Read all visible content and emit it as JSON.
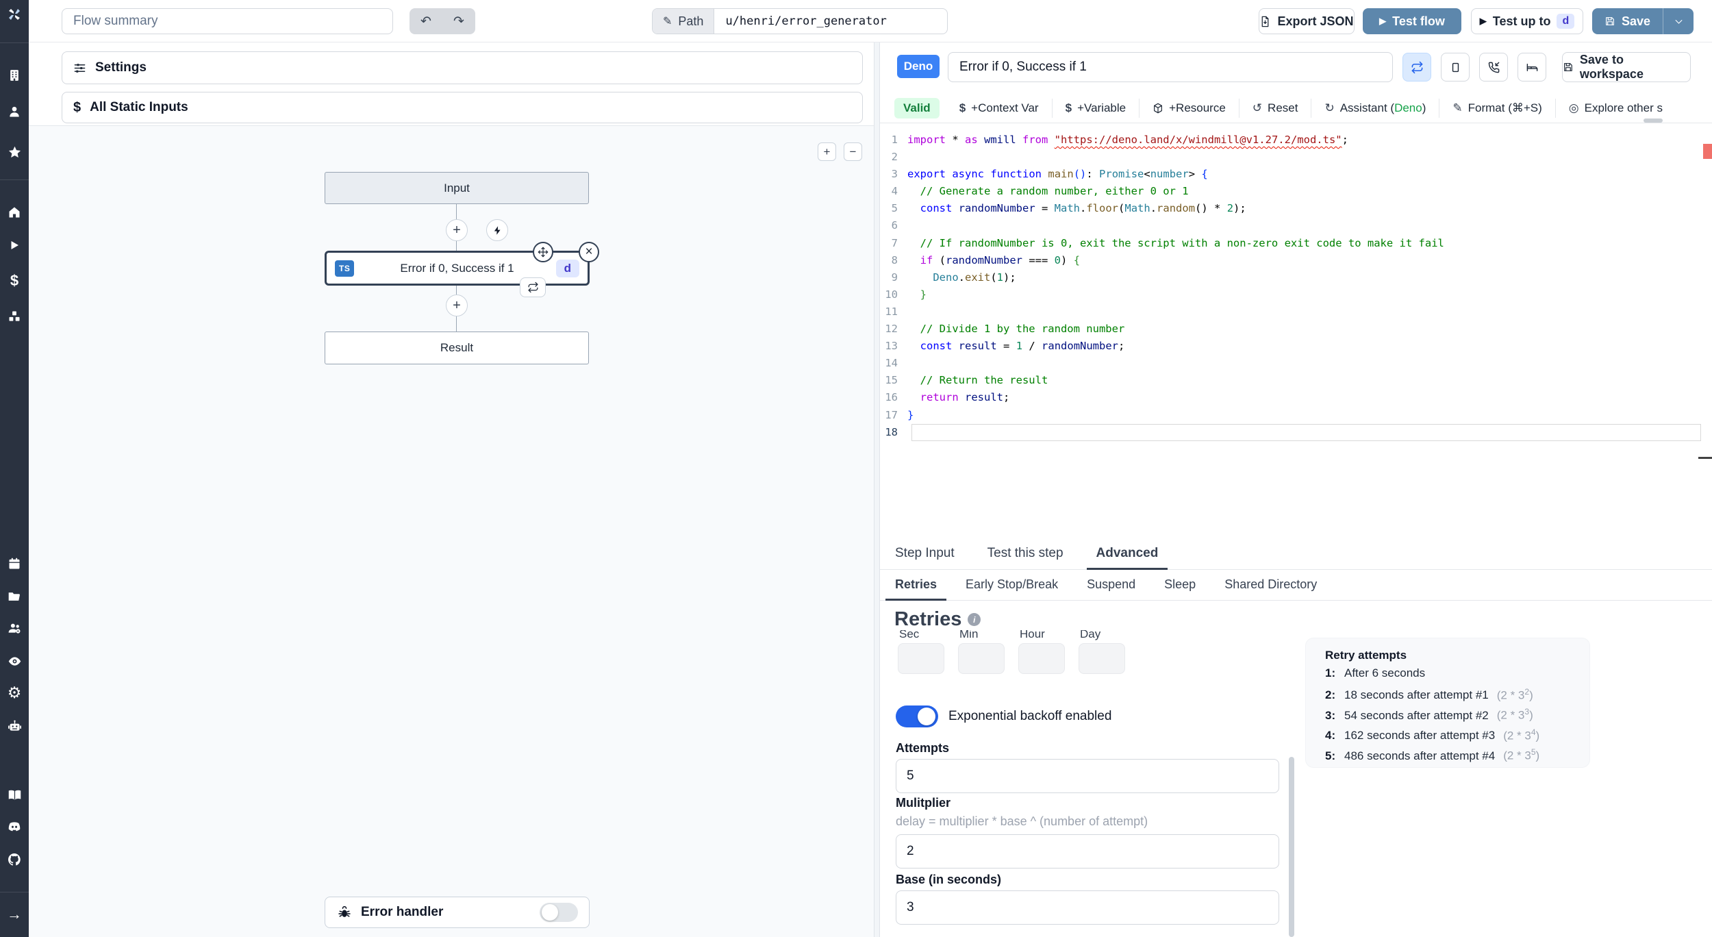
{
  "colors": {
    "accent_button": "#5d87ac",
    "deno_badge": "#3b82f6",
    "ts_badge": "#3178c6",
    "d_badge_text": "#4338ca",
    "valid_green": "#15803d",
    "toggle_on": "#2563eb",
    "sidebar_bg": "#2a3240",
    "canvas_bg": "#f8fafc"
  },
  "icons": {
    "undo": "↶",
    "redo": "↷",
    "pencil": "✎",
    "play": "▶",
    "dollar": "$",
    "reset": "↺",
    "assistant": "↻",
    "format": "✎",
    "explore": "◎",
    "close": "×",
    "plus": "+",
    "minus": "−",
    "info": "i",
    "arrow_right": "→",
    "gear": "⚙",
    "star": "★"
  },
  "sidebar": {
    "icons": [
      "windmill-logo",
      "building",
      "user",
      "star",
      "home",
      "play",
      "dollar",
      "boxes",
      "calendar",
      "folder",
      "users-gear",
      "eye",
      "gear",
      "robot",
      "book",
      "discord",
      "github",
      "arrow-right"
    ]
  },
  "topbar": {
    "flow_summary_placeholder": "Flow summary",
    "path_label": "Path",
    "path_value": "u/henri/error_generator",
    "export_json": "Export JSON",
    "test_flow": "Test flow",
    "test_up_to": "Test up to",
    "test_up_to_badge": "d",
    "save": "Save"
  },
  "left_panel": {
    "settings": "Settings",
    "all_static_inputs": "All Static Inputs"
  },
  "flow": {
    "input_node": "Input",
    "step_node": {
      "lang_badge": "TS",
      "title": "Error if 0, Success if 1",
      "id_badge": "d"
    },
    "result_node": "Result",
    "error_handler": "Error handler"
  },
  "step_editor": {
    "lang_badge": "Deno",
    "summary_value": "Error if 0, Success if 1",
    "save_to_workspace": "Save to workspace",
    "valid": "Valid",
    "toolbar": {
      "context_var": "+Context Var",
      "variable": "+Variable",
      "resource": "+Resource",
      "reset": "Reset",
      "assistant_prefix": "Assistant (",
      "assistant_lang": "Deno",
      "assistant_suffix": ")",
      "format": "Format (⌘+S)",
      "explore": "Explore other s"
    }
  },
  "editor": {
    "active_line": 18,
    "lines": [
      {
        "segs": [
          [
            "kw2",
            "import"
          ],
          [
            "d",
            " * "
          ],
          [
            "kw2",
            "as"
          ],
          [
            "v",
            " wmill "
          ],
          [
            "kw2",
            "from"
          ],
          [
            "d",
            " "
          ],
          [
            "str-u",
            "\"https://deno.land/x/windmill@v1.27.2/mod.ts\""
          ],
          [
            "d",
            ";"
          ]
        ]
      },
      {
        "segs": []
      },
      {
        "segs": [
          [
            "kw",
            "export"
          ],
          [
            "d",
            " "
          ],
          [
            "kw",
            "async"
          ],
          [
            "d",
            " "
          ],
          [
            "kw",
            "function"
          ],
          [
            "d",
            " "
          ],
          [
            "fn",
            "main"
          ],
          [
            "b1",
            "()"
          ],
          [
            "d",
            ": "
          ],
          [
            "ty",
            "Promise"
          ],
          [
            "d",
            "<"
          ],
          [
            "ty",
            "number"
          ],
          [
            "d",
            "> "
          ],
          [
            "b1",
            "{"
          ]
        ]
      },
      {
        "segs": [
          [
            "c",
            "  // Generate a random number, either 0 or 1"
          ]
        ]
      },
      {
        "segs": [
          [
            "d",
            "  "
          ],
          [
            "kw",
            "const"
          ],
          [
            "d",
            " "
          ],
          [
            "v",
            "randomNumber"
          ],
          [
            "d",
            " = "
          ],
          [
            "ty",
            "Math"
          ],
          [
            "d",
            "."
          ],
          [
            "fn",
            "floor"
          ],
          [
            "d",
            "("
          ],
          [
            "ty",
            "Math"
          ],
          [
            "d",
            "."
          ],
          [
            "fn",
            "random"
          ],
          [
            "d",
            "() * "
          ],
          [
            "num",
            "2"
          ],
          [
            "d",
            ");"
          ]
        ]
      },
      {
        "segs": []
      },
      {
        "segs": [
          [
            "c",
            "  // If randomNumber is 0, exit the script with a non-zero exit code to make it fail"
          ]
        ]
      },
      {
        "segs": [
          [
            "d",
            "  "
          ],
          [
            "kw2",
            "if"
          ],
          [
            "d",
            " ("
          ],
          [
            "v",
            "randomNumber"
          ],
          [
            "d",
            " === "
          ],
          [
            "num",
            "0"
          ],
          [
            "d",
            ") "
          ],
          [
            "b2",
            "{"
          ]
        ]
      },
      {
        "segs": [
          [
            "d",
            "    "
          ],
          [
            "ty",
            "Deno"
          ],
          [
            "d",
            "."
          ],
          [
            "fn",
            "exit"
          ],
          [
            "d",
            "("
          ],
          [
            "num",
            "1"
          ],
          [
            "d",
            ");"
          ]
        ]
      },
      {
        "segs": [
          [
            "d",
            "  "
          ],
          [
            "b2",
            "}"
          ]
        ]
      },
      {
        "segs": []
      },
      {
        "segs": [
          [
            "c",
            "  // Divide 1 by the random number"
          ]
        ]
      },
      {
        "segs": [
          [
            "d",
            "  "
          ],
          [
            "kw",
            "const"
          ],
          [
            "d",
            " "
          ],
          [
            "v",
            "result"
          ],
          [
            "d",
            " = "
          ],
          [
            "num",
            "1"
          ],
          [
            "d",
            " / "
          ],
          [
            "v",
            "randomNumber"
          ],
          [
            "d",
            ";"
          ]
        ]
      },
      {
        "segs": []
      },
      {
        "segs": [
          [
            "c",
            "  // Return the result"
          ]
        ]
      },
      {
        "segs": [
          [
            "d",
            "  "
          ],
          [
            "kw2",
            "return"
          ],
          [
            "d",
            " "
          ],
          [
            "v",
            "result"
          ],
          [
            "d",
            ";"
          ]
        ]
      },
      {
        "segs": [
          [
            "b1",
            "}"
          ]
        ]
      },
      {
        "segs": []
      }
    ]
  },
  "tabs": {
    "items": [
      "Step Input",
      "Test this step",
      "Advanced"
    ],
    "active": "Advanced"
  },
  "subtabs": {
    "items": [
      "Retries",
      "Early Stop/Break",
      "Suspend",
      "Sleep",
      "Shared Directory"
    ],
    "active": "Retries"
  },
  "retries": {
    "title": "Retries",
    "schedule_labels": [
      "Sec",
      "Min",
      "Hour",
      "Day"
    ],
    "backoff_label": "Exponential backoff enabled",
    "attempts_label": "Attempts",
    "attempts_value": "5",
    "multiplier_label": "Mulitplier",
    "multiplier_help": "delay = multiplier * base ^ (number of attempt)",
    "multiplier_value": "2",
    "base_label": "Base (in seconds)",
    "base_value": "3",
    "retry_attempts": {
      "title": "Retry attempts",
      "items": [
        {
          "index": "1:",
          "text": "After 6 seconds"
        },
        {
          "index": "2:",
          "text": "18 seconds after attempt #1",
          "f_open": "(2 * 3",
          "f_exp": "2",
          "f_close": ")"
        },
        {
          "index": "3:",
          "text": "54 seconds after attempt #2",
          "f_open": "(2 * 3",
          "f_exp": "3",
          "f_close": ")"
        },
        {
          "index": "4:",
          "text": "162 seconds after attempt #3",
          "f_open": "(2 * 3",
          "f_exp": "4",
          "f_close": ")"
        },
        {
          "index": "5:",
          "text": "486 seconds after attempt #4",
          "f_open": "(2 * 3",
          "f_exp": "5",
          "f_close": ")"
        }
      ]
    }
  }
}
